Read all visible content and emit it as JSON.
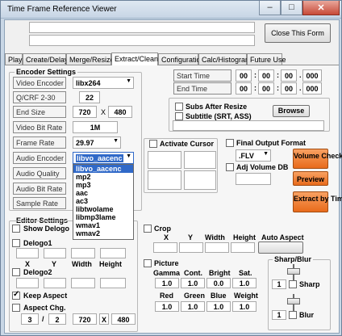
{
  "window": {
    "title": "Time Frame Reference Viewer"
  },
  "header": {
    "close_form_label": "Close This Form"
  },
  "tabs": [
    {
      "label": "Play"
    },
    {
      "label": "Create/Delay"
    },
    {
      "label": "Merge/Resize"
    },
    {
      "label": "Extract/Clean"
    },
    {
      "label": "Configuration"
    },
    {
      "label": "Calc/Histogram"
    },
    {
      "label": "Future Use"
    }
  ],
  "encoder": {
    "section_label": "Encoder Settings",
    "video_encoder_label": "Video Encoder",
    "video_encoder_value": "libx264",
    "q_crf_label": "Q/CRF  2-30",
    "q_crf_value": "22",
    "end_size_label": "End Size",
    "end_size_w": "720",
    "end_size_x": "X",
    "end_size_h": "480",
    "video_bit_rate_label": "Video Bit Rate",
    "video_bit_rate_value": "1M",
    "frame_rate_label": "Frame Rate",
    "frame_rate_value": "29.97",
    "audio_encoder_label": "Audio Encoder",
    "audio_encoder_value": "libvo_aacenc",
    "audio_quality_label": "Audio Quality",
    "audio_bit_rate_label": "Audio Bit Rate",
    "sample_rate_label": "Sample Rate",
    "audio_options": [
      "libvo_aacenc",
      "mp2",
      "mp3",
      "aac",
      "ac3",
      "libtwolame",
      "libmp3lame",
      "wmav1",
      "wmav2"
    ]
  },
  "time": {
    "start_label": "Start Time",
    "end_label": "End Time",
    "start": {
      "h": "00",
      "m": "00",
      "s": "00",
      "ms": "000"
    },
    "end": {
      "h": "00",
      "m": "00",
      "s": "00",
      "ms": "000"
    },
    "sep": ":",
    "dot": "."
  },
  "subs": {
    "subs_after_resize_label": "Subs After Resize",
    "subtitle_label": "Subtitle (SRT, ASS)",
    "browse_label": "Browse"
  },
  "cursor": {
    "activate_label": "Activate Cursor"
  },
  "output": {
    "final_format_label": "Final Output Format",
    "format_value": ".FLV",
    "adj_volume_label": "Adj Volume DB"
  },
  "actions": {
    "volume_check": "Volume Check",
    "preview": "Preview",
    "extract": "Extract by Time"
  },
  "editor": {
    "section_label": "Editor Settings",
    "show_delogo_label": "Show Delogo",
    "delogo1_label": "Delogo1",
    "delogo2_label": "Delogo2",
    "x_label": "X",
    "y_label": "Y",
    "width_label": "Width",
    "height_label": "Height",
    "keep_aspect_label": "Keep Aspect",
    "aspect_chg_label": "Aspect Chg.",
    "aspect_num": "3",
    "aspect_slash": "/",
    "aspect_den": "2",
    "aspect_w": "720",
    "aspect_x": "X",
    "aspect_h": "480"
  },
  "crop": {
    "label": "Crop",
    "x_label": "X",
    "y_label": "Y",
    "width_label": "Width",
    "height_label": "Height",
    "auto_aspect_label": "Auto Aspect"
  },
  "picture": {
    "label": "Picture",
    "gamma_label": "Gamma",
    "cont_label": "Cont.",
    "bright_label": "Bright",
    "sat_label": "Sat.",
    "gamma": "1.0",
    "cont": "1.0",
    "bright": "0.0",
    "sat": "1.0",
    "red_label": "Red",
    "green_label": "Green",
    "blue_label": "Blue",
    "weight_label": "Weight",
    "red": "1.0",
    "green": "1.0",
    "blue": "1.0",
    "weight": "1.0"
  },
  "sharp_blur": {
    "label": "Sharp/Blur",
    "sharp_value": "1",
    "sharp_label": "Sharp",
    "blur_value": "1",
    "blur_label": "Blur"
  }
}
